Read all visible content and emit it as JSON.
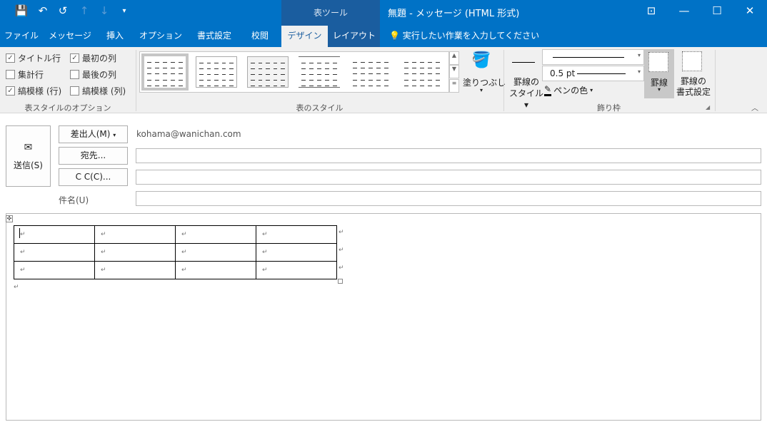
{
  "window": {
    "title": "無題 - メッセージ (HTML 形式)",
    "context_tab": "表ツール"
  },
  "quick_access": [
    "save-icon",
    "undo-icon",
    "redo-icon",
    "up-icon",
    "down-icon",
    "customize-icon"
  ],
  "tabs": [
    {
      "label": "ファイル"
    },
    {
      "label": "メッセージ"
    },
    {
      "label": "挿入"
    },
    {
      "label": "オプション"
    },
    {
      "label": "書式設定"
    },
    {
      "label": "校閲"
    },
    {
      "label": "デザイン",
      "active": true
    },
    {
      "label": "レイアウト"
    }
  ],
  "tell_me": "実行したい作業を入力してください",
  "ribbon": {
    "options": {
      "items": [
        {
          "label": "タイトル行",
          "checked": true
        },
        {
          "label": "最初の列",
          "checked": true
        },
        {
          "label": "集計行",
          "checked": false
        },
        {
          "label": "最後の列",
          "checked": false
        },
        {
          "label": "縞模様 (行)",
          "checked": true
        },
        {
          "label": "縞模様 (列)",
          "checked": false
        }
      ],
      "group": "表スタイルのオプション"
    },
    "styles": {
      "group": "表のスタイル",
      "shading": "塗りつぶし"
    },
    "borders": {
      "style_label1": "罫線の",
      "style_label2": "スタイル",
      "weight": "0.5 pt",
      "pen_color": "ペンの色",
      "borders": "罫線",
      "painter1": "罫線の",
      "painter2": "書式設定",
      "group": "飾り枠"
    }
  },
  "compose": {
    "send": "送信(S)",
    "from": "差出人(M)",
    "from_value": "kohama@wanichan.com",
    "to": "宛先...",
    "cc": "C C(C)...",
    "subject": "件名(U)",
    "to_value": "",
    "cc_value": "",
    "subject_value": ""
  },
  "table": {
    "rows": 3,
    "cols": 4,
    "cell_mark": "↵"
  }
}
